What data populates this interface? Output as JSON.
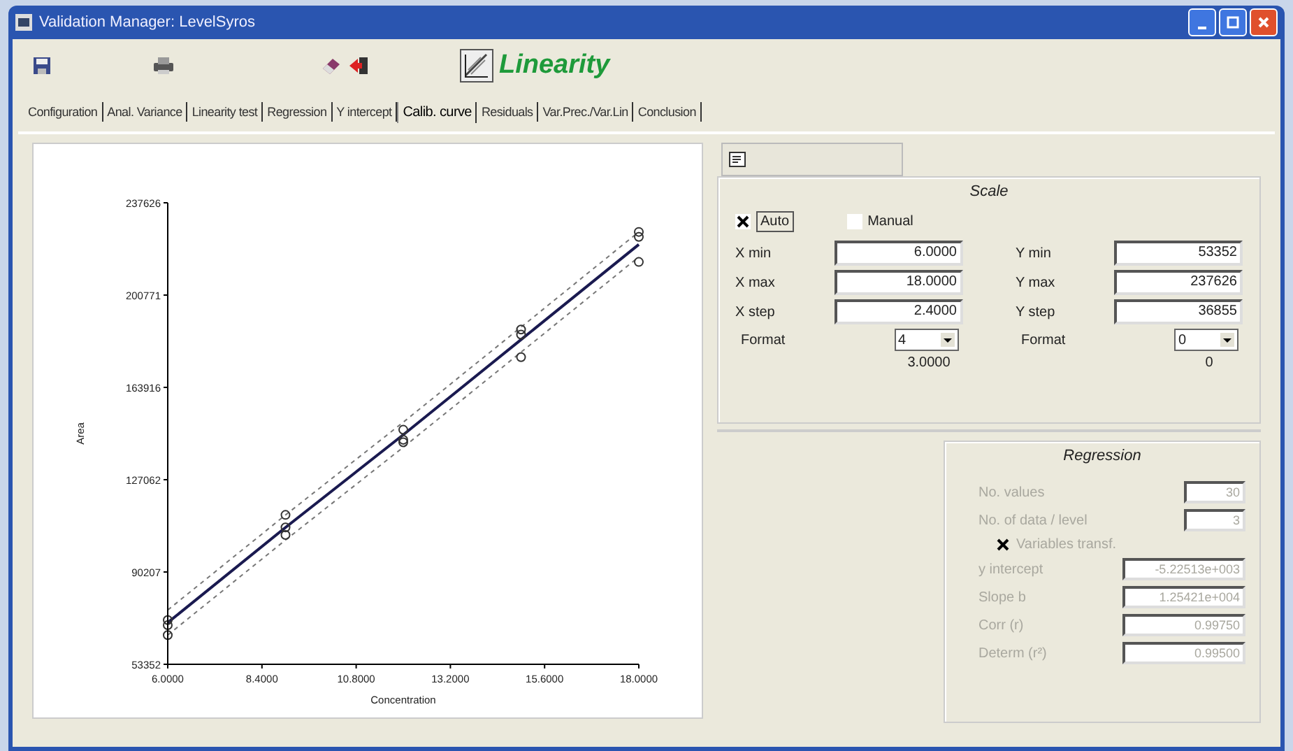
{
  "window": {
    "title": "Validation Manager: LevelSyros"
  },
  "toolbar": {
    "module_title": "Linearity"
  },
  "tabs": [
    {
      "label": "Configuration",
      "selected": false
    },
    {
      "label": "Anal. Variance",
      "selected": false
    },
    {
      "label": "Linearity test",
      "selected": false
    },
    {
      "label": "Regression",
      "selected": false
    },
    {
      "label": "Y intercept",
      "selected": false
    },
    {
      "label": "Calib. curve",
      "selected": true
    },
    {
      "label": "Residuals",
      "selected": false
    },
    {
      "label": "Var.Prec./Var.Lin",
      "selected": false
    },
    {
      "label": "Conclusion",
      "selected": false
    }
  ],
  "chart": {
    "chart_data": {
      "type": "scatter",
      "xlabel": "Concentration",
      "ylabel": "Area",
      "x": [
        6,
        6,
        6,
        9,
        9,
        9,
        12,
        12,
        12,
        15,
        15,
        15,
        18,
        18,
        18
      ],
      "series": [
        {
          "color": "#333333",
          "values": [
            71000,
            69000,
            65000,
            113000,
            108000,
            105000,
            147000,
            143000,
            142000,
            187000,
            185000,
            176000,
            226000,
            224000,
            214000
          ]
        },
        {
          "type": "line",
          "color": "#1a1a50",
          "values": [
            70000,
            70000,
            70000,
            108000,
            108000,
            108000,
            145000,
            145000,
            145000,
            183000,
            183000,
            183000,
            221000,
            221000,
            221000
          ]
        },
        {
          "type": "line",
          "line_style": "dashed",
          "color": "#777777",
          "values": [
            75000,
            75000,
            75000,
            113000,
            113000,
            113000,
            150000,
            150000,
            150000,
            188000,
            188000,
            188000,
            226000,
            226000,
            226000
          ]
        },
        {
          "type": "line",
          "line_style": "dashed",
          "color": "#777777",
          "values": [
            65000,
            65000,
            65000,
            103000,
            103000,
            103000,
            140000,
            140000,
            140000,
            178000,
            178000,
            178000,
            216000,
            216000,
            216000
          ]
        }
      ],
      "xlim": [
        6,
        18
      ],
      "ylim": [
        53352,
        237626
      ],
      "xticks": [
        {
          "value": 6,
          "label": "6.0000"
        },
        {
          "value": 8.4,
          "label": "8.4000"
        },
        {
          "value": 10.8,
          "label": "10.8000"
        },
        {
          "value": 13.2,
          "label": "13.2000"
        },
        {
          "value": 15.6,
          "label": "15.6000"
        },
        {
          "value": 18,
          "label": "18.0000"
        }
      ],
      "yticks": [
        53352,
        90207,
        127062,
        163916,
        200771,
        237626
      ]
    }
  },
  "scale": {
    "title": "Scale",
    "auto": {
      "label": "Auto",
      "checked": true
    },
    "manual": {
      "label": "Manual",
      "checked": false
    },
    "x_fields": [
      {
        "label": "X min",
        "value": "6.0000"
      },
      {
        "label": "X max",
        "value": "18.0000"
      },
      {
        "label": "X step",
        "value": "2.4000"
      }
    ],
    "y_fields": [
      {
        "label": "Y min",
        "value": "53352"
      },
      {
        "label": "Y max",
        "value": "237626"
      },
      {
        "label": "Y step",
        "value": "36855"
      }
    ],
    "x_format": {
      "label": "Format",
      "value": "4",
      "reading": "3.0000"
    },
    "y_format": {
      "label": "Format",
      "value": "0",
      "reading": "0"
    }
  },
  "regression": {
    "title": "Regression",
    "counts": [
      {
        "label": "No. values",
        "value": "30",
        "disabled": true
      },
      {
        "label": "No. of data / level",
        "value": "3",
        "disabled": true
      }
    ],
    "variables_transf": {
      "label": "Variables transf.",
      "checked": true
    },
    "results": [
      {
        "label": "y intercept",
        "value": "-5.22513e+003",
        "disabled": true
      },
      {
        "label": "Slope b",
        "value": "1.25421e+004",
        "disabled": true
      },
      {
        "label": "Corr (r)",
        "value": "0.99750",
        "disabled": true
      },
      {
        "label": "Determ (r²)",
        "value": "0.99500",
        "disabled": true
      }
    ]
  }
}
